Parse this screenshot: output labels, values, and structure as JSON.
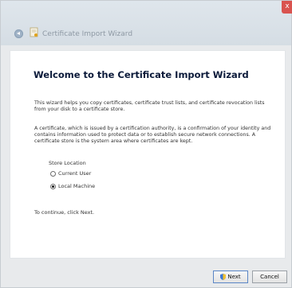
{
  "window": {
    "title": "Certificate Import Wizard",
    "close_glyph": "x"
  },
  "main": {
    "heading": "Welcome to the Certificate Import Wizard",
    "intro": "This wizard helps you copy certificates, certificate trust lists, and certificate revocation lists from your disk to a certificate store.",
    "description": "A certificate, which is issued by a certification authority, is a confirmation of your identity and contains information used to protect data or to establish secure network connections. A certificate store is the system area where certificates are kept.",
    "store_location": {
      "label": "Store Location",
      "options": [
        {
          "label": "Current User",
          "selected": false
        },
        {
          "label": "Local Machine",
          "selected": true
        }
      ]
    },
    "continue_text": "To continue, click Next."
  },
  "footer": {
    "next_label": "Next",
    "cancel_label": "Cancel"
  },
  "icons": {
    "back": "back-arrow-icon",
    "certificate": "certificate-icon",
    "shield": "uac-shield-icon"
  }
}
